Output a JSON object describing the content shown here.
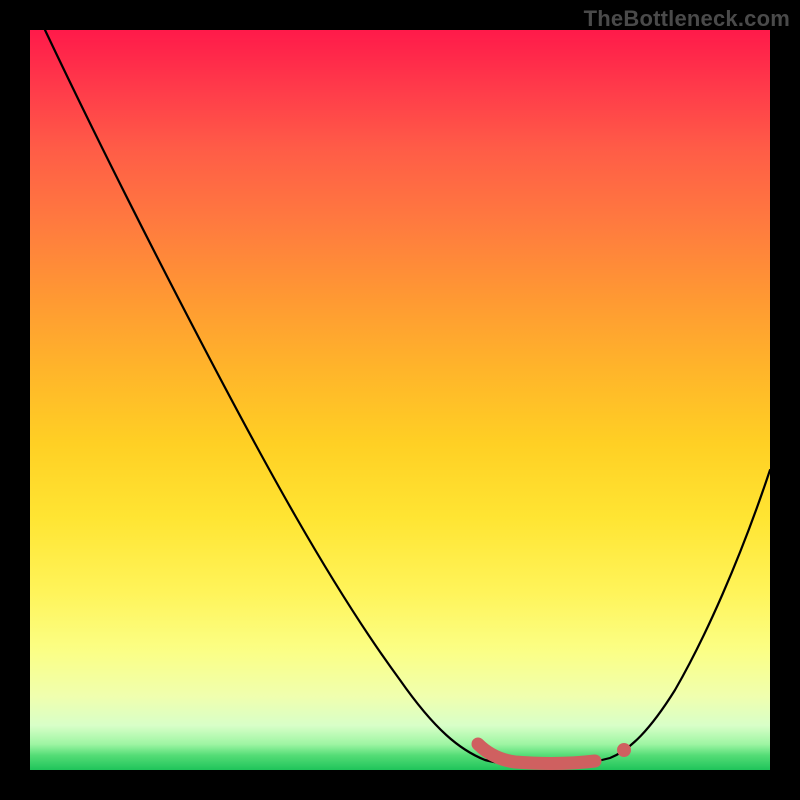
{
  "watermark": "TheBottleneck.com",
  "chart_data": {
    "type": "line",
    "title": "",
    "xlabel": "",
    "ylabel": "",
    "xlim": [
      0,
      100
    ],
    "ylim": [
      0,
      100
    ],
    "grid": false,
    "legend": false,
    "background_gradient": {
      "top": "#ff1a4a",
      "mid": "#ffd024",
      "bottom": "#1fc45a"
    },
    "series": [
      {
        "name": "bottleneck-curve",
        "color": "#000000",
        "x": [
          2,
          10,
          20,
          30,
          40,
          50,
          57,
          61,
          65,
          70,
          75,
          80,
          85,
          90,
          95,
          100
        ],
        "y": [
          100,
          86,
          70,
          55,
          40,
          25,
          12,
          5,
          1,
          0,
          0,
          1,
          6,
          15,
          27,
          41
        ]
      }
    ],
    "markers": [
      {
        "name": "optimal-range-segment",
        "type": "segment",
        "color": "#cf6060",
        "x": [
          61,
          65,
          70,
          75,
          80
        ],
        "y": [
          4,
          1,
          0,
          0,
          1
        ]
      },
      {
        "name": "optimal-point",
        "type": "point",
        "color": "#cf6060",
        "x": 80,
        "y": 1
      }
    ]
  }
}
